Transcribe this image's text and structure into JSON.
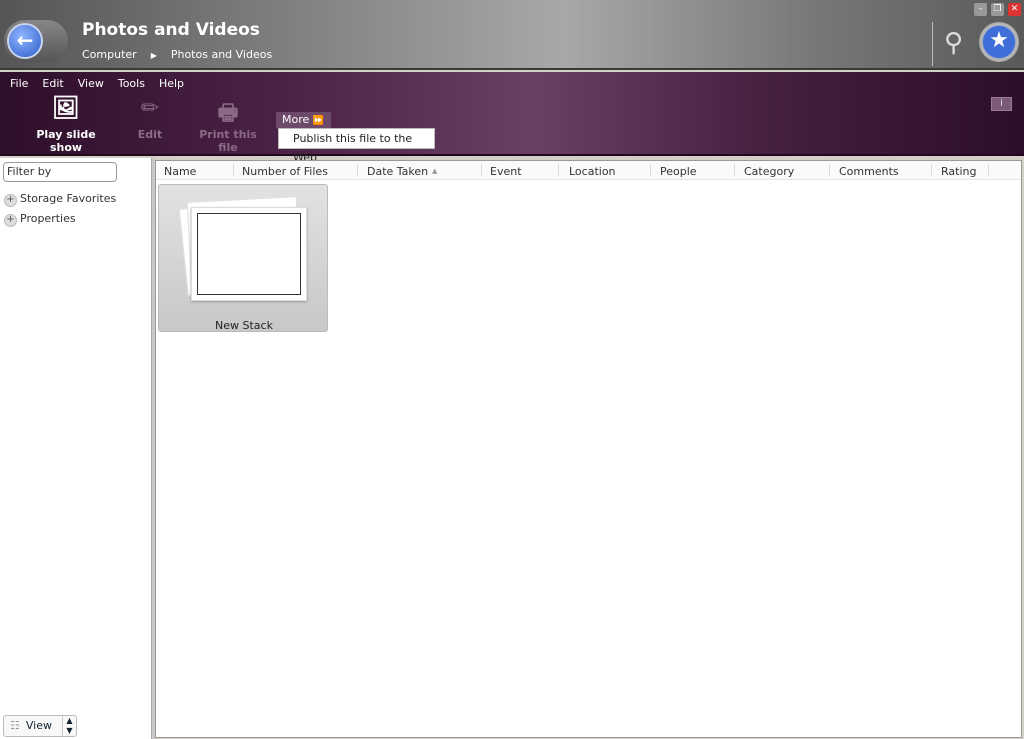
{
  "window": {
    "title": "Photos and Videos",
    "breadcrumb": [
      "Computer",
      "Photos and Videos"
    ],
    "minimize": "–",
    "restore": "❐",
    "close": "✕"
  },
  "menu": [
    "File",
    "Edit",
    "View",
    "Tools",
    "Help"
  ],
  "toolbar": {
    "play": "Play slide show",
    "edit": "Edit",
    "print": "Print this file",
    "more": "More",
    "more_icon": "⏩",
    "publish": "Publish this file to the Web",
    "info": "i"
  },
  "sidebar": {
    "filter_placeholder": "Filter by",
    "items": [
      "Storage Favorites",
      "Properties"
    ],
    "view_label": "View"
  },
  "columns": [
    "Name",
    "Number of Files",
    "Date Taken",
    "Event",
    "Location",
    "People",
    "Category",
    "Comments",
    "Rating"
  ],
  "sort_indicator": "▲",
  "items": [
    {
      "name": "New Stack"
    }
  ]
}
